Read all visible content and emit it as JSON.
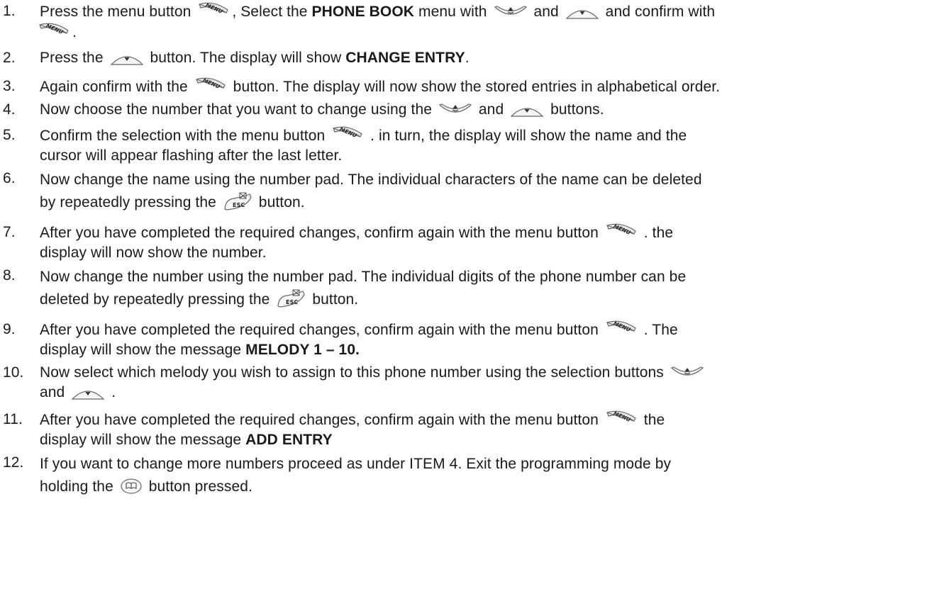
{
  "steps": [
    {
      "n": "1.",
      "a": "Press the menu button ",
      "b": ", Select the ",
      "c": "PHONE BOOK",
      "d": " menu with ",
      "e": " and ",
      "f": " and confirm with",
      "g": "."
    },
    {
      "n": "2.",
      "a": "Press the ",
      "b": " button. The display will show ",
      "c": "CHANGE ENTRY",
      "d": "."
    },
    {
      "n": "3.",
      "a": "Again confirm with the ",
      "b": " button. The display will now show the stored entries in alphabetical order."
    },
    {
      "n": "4.",
      "a": "Now choose the number that you want to change using the ",
      "b": " and ",
      "c": " buttons."
    },
    {
      "n": "5.",
      "a": "Confirm the selection with the menu button ",
      "b": " . in turn, the display will show the name and the",
      "c": "cursor will appear flashing after the last letter."
    },
    {
      "n": "6.",
      "a": "Now change the name using the number pad. The individual characters of the name can be deleted",
      "b": "by repeatedly pressing the ",
      "c": " button."
    },
    {
      "n": "7.",
      "a": "After you have completed the required changes, confirm again with the menu button ",
      "b": " . the",
      "c": "display will now show the number."
    },
    {
      "n": "8.",
      "a": "Now change the number using the number pad. The individual digits of the phone number can be",
      "b": "deleted by repeatedly pressing the ",
      "c": " button."
    },
    {
      "n": "9.",
      "a": "After you have completed the required changes, confirm again with the menu button ",
      "b": " . The",
      "c": "display will show the message ",
      "d": "MELODY 1 – 10."
    },
    {
      "n": "10.",
      "a": "Now select which melody you wish to assign to this phone number using the selection buttons ",
      "b": "and ",
      "c": " ."
    },
    {
      "n": "11.",
      "a": "After you have completed the required changes, confirm again with the menu button ",
      "b": " the",
      "c": "display will show the message ",
      "d": "ADD ENTRY"
    },
    {
      "n": "12.",
      "a": "If you want to change more numbers proceed as under ITEM 4. Exit the programming mode by",
      "b": "holding the ",
      "c": " button pressed."
    }
  ],
  "icons": {
    "menu_label": "MENU",
    "esc_label": "ESC"
  },
  "colors": {
    "text": "#1a1a1a",
    "icon_stroke": "#666666",
    "icon_fill": "#f6f6f6"
  }
}
